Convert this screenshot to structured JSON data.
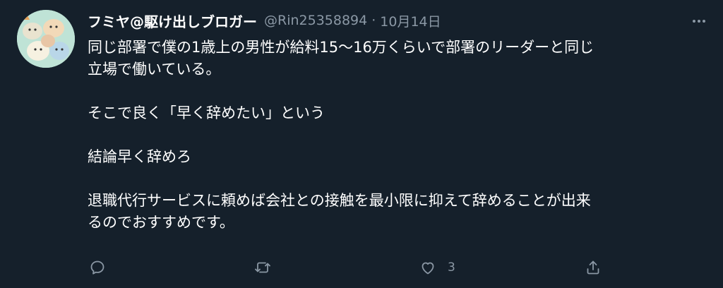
{
  "tweet": {
    "display_name": "フミヤ@駆け出しブロガー",
    "handle": "@Rin25358894",
    "separator": "·",
    "date": "10月14日",
    "paragraphs": [
      "同じ部署で僕の1歳上の男性が給料15〜16万くらいで部署のリーダーと同じ\n立場で働いている。",
      "そこで良く「早く辞めたい」という",
      "結論早く辞めろ",
      "退職代行サービスに頼めば会社との接触を最小限に抑えて辞めることが出来\nるのでおすすめです。"
    ],
    "actions": {
      "reply_icon": "reply-icon",
      "retweet_icon": "retweet-icon",
      "like_icon": "like-icon",
      "like_count": "3",
      "share_icon": "share-icon"
    }
  },
  "colors": {
    "background": "#15202b",
    "text_primary": "#ffffff",
    "text_secondary": "#8b98a5"
  }
}
